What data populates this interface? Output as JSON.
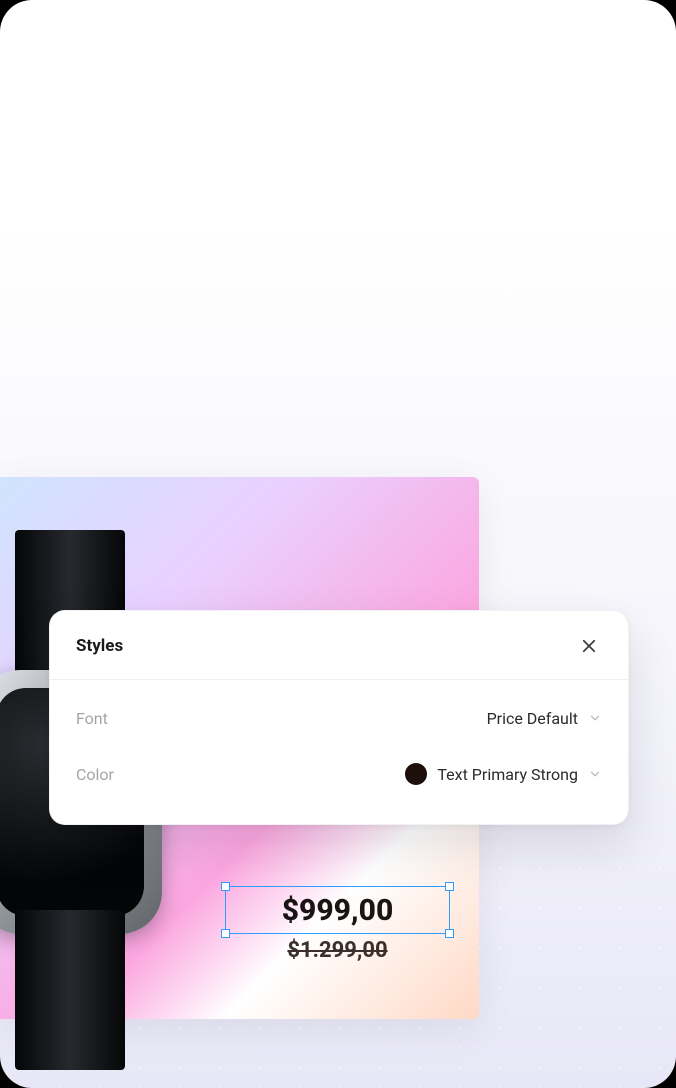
{
  "panel": {
    "title": "Styles",
    "rows": {
      "font": {
        "label": "Font",
        "value": "Price Default"
      },
      "color": {
        "label": "Color",
        "value": "Text Primary Strong",
        "swatch": "#1d0f0b"
      }
    }
  },
  "prices": {
    "current": "$999,00",
    "original": "$1.299,00"
  }
}
